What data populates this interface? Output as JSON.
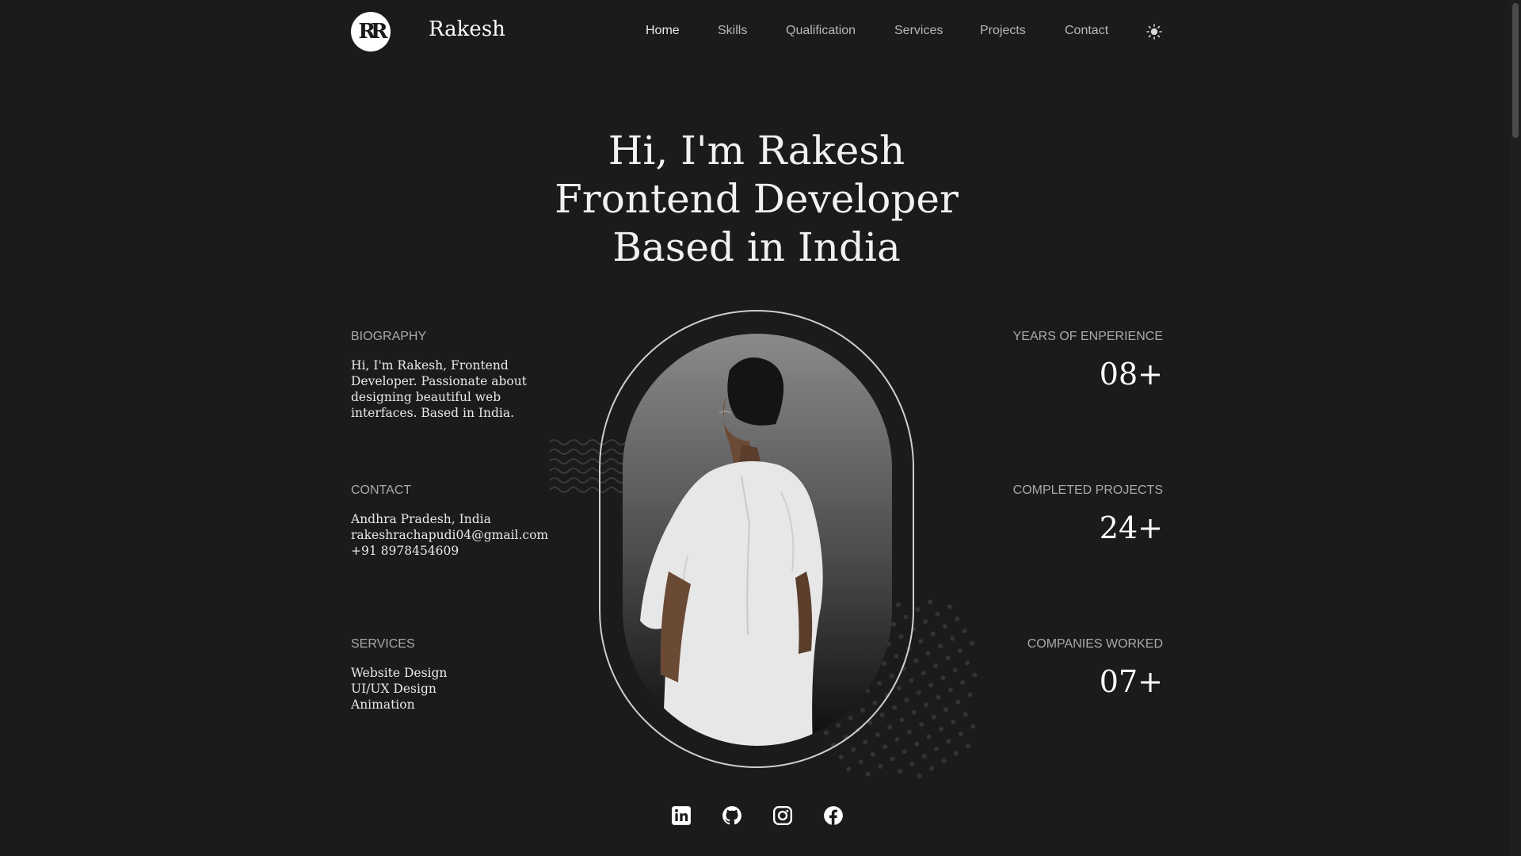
{
  "header": {
    "logo_text": "R",
    "brand": "Rakesh",
    "nav": [
      "Home",
      "Skills",
      "Qualification",
      "Services",
      "Projects",
      "Contact"
    ],
    "theme_icon": "sun-icon"
  },
  "hero": {
    "lines": [
      "Hi, I'm Rakesh",
      "Frontend Developer",
      "Based in India"
    ]
  },
  "biography": {
    "label": "BIOGRAPHY",
    "lines": [
      "Hi, I'm Rakesh, Frontend",
      "Developer. Passionate about",
      "designing beautiful web",
      "interfaces. Based in India."
    ]
  },
  "contact": {
    "label": "CONTACT",
    "lines": [
      "Andhra Pradesh, India",
      "rakeshrachapudi04@gmail.com",
      "+91 8978454609"
    ]
  },
  "services": {
    "label": "SERVICES",
    "lines": [
      "Website Design",
      "UI/UX Design",
      "Animation"
    ]
  },
  "stats": [
    {
      "label": "YEARS OF ENPERIENCE",
      "value": "08+"
    },
    {
      "label": "COMPLETED PROJECTS",
      "value": "24+"
    },
    {
      "label": "COMPANIES WORKED",
      "value": "07+"
    }
  ],
  "social": [
    "linkedin-icon",
    "github-icon",
    "instagram-icon",
    "facebook-icon"
  ],
  "colors": {
    "background": "#1b1b1d",
    "text": "#ffffff",
    "muted": "#a9a9ab"
  }
}
